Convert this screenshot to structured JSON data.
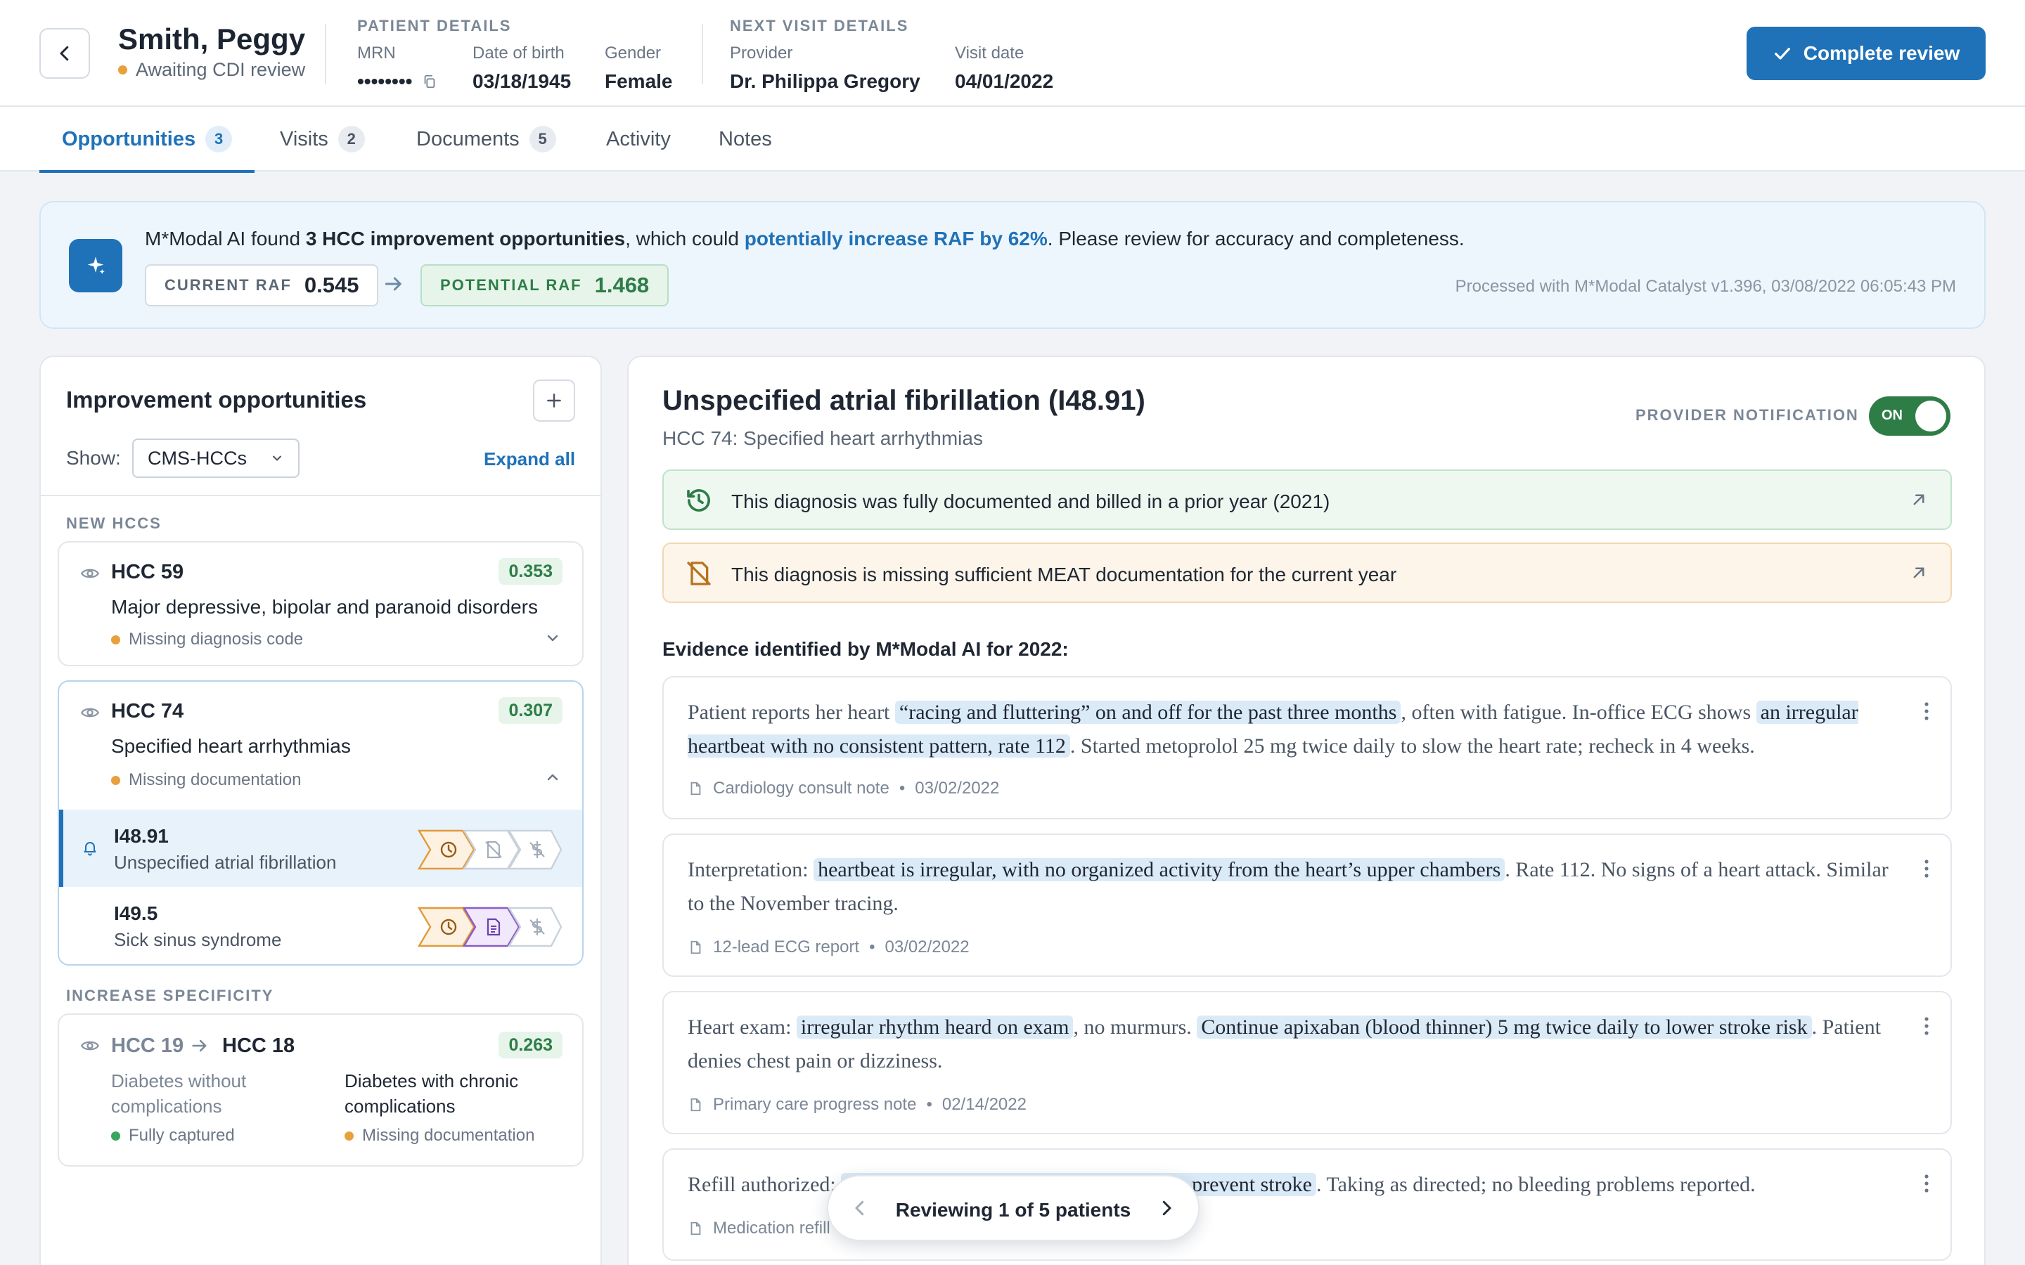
{
  "header": {
    "back_icon": "chevron-left-icon",
    "patient_name": "Smith, Peggy",
    "patient_status": "Awaiting CDI review",
    "patient_details_label": "PATIENT DETAILS",
    "mrn_label": "MRN",
    "mrn_value": "••••••••",
    "dob_label": "Date of birth",
    "dob_value": "03/18/1945",
    "gender_label": "Gender",
    "gender_value": "Female",
    "next_visit_label": "NEXT VISIT DETAILS",
    "provider_label": "Provider",
    "provider_value": "Dr. Philippa Gregory",
    "visit_date_label": "Visit date",
    "visit_date_value": "04/01/2022",
    "complete_button": "Complete review",
    "accent_color": "#1f72b8"
  },
  "tabs": [
    {
      "label": "Opportunities",
      "count": "3",
      "active": true
    },
    {
      "label": "Visits",
      "count": "2",
      "active": false
    },
    {
      "label": "Documents",
      "count": "5",
      "active": false
    },
    {
      "label": "Activity",
      "count": "",
      "active": false
    },
    {
      "label": "Notes",
      "count": "",
      "active": false
    }
  ],
  "banner": {
    "text_prefix": "M*Modal AI found ",
    "text_bold": "3 HCC improvement opportunities",
    "text_mid": ", which could ",
    "text_highlight": "potentially increase RAF by 62%",
    "text_suffix": ". Please review for accuracy and completeness.",
    "current_raf_label": "CURRENT RAF",
    "current_raf_value": "0.545",
    "potential_raf_label": "POTENTIAL RAF",
    "potential_raf_value": "1.468",
    "processed": "Processed with M*Modal Catalyst v1.396, 03/08/2022 06:05:43 PM"
  },
  "left": {
    "title": "Improvement opportunities",
    "show_label": "Show:",
    "show_value": "CMS-HCCs",
    "expand_all": "Expand all",
    "new_hccs_label": "NEW HCCS",
    "increase_specificity_label": "INCREASE SPECIFICITY",
    "hcc59": {
      "code": "HCC 59",
      "score": "0.353",
      "desc": "Major depressive, bipolar and paranoid disorders",
      "status": "Missing diagnosis code"
    },
    "hcc74": {
      "code": "HCC 74",
      "score": "0.307",
      "desc": "Specified heart arrhythmias",
      "status": "Missing documentation",
      "codes": [
        {
          "id": "I48.91",
          "desc": "Unspecified atrial fibrillation"
        },
        {
          "id": "I49.5",
          "desc": "Sick sinus syndrome"
        }
      ]
    },
    "spec": {
      "from_code": "HCC 19",
      "to_code": "HCC 18",
      "score": "0.263",
      "from_desc": "Diabetes without complications",
      "from_status": "Fully captured",
      "to_desc": "Diabetes with chronic complications",
      "to_status": "Missing documentation"
    }
  },
  "right": {
    "title": "Unspecified atrial fibrillation (I48.91)",
    "subtitle": "HCC 74: Specified heart arrhythmias",
    "provider_notification_label": "PROVIDER NOTIFICATION",
    "toggle_label": "ON",
    "alert_prior": "This diagnosis was fully documented and billed in a prior year (2021)",
    "alert_meat": "This diagnosis is missing sufficient MEAT documentation for the current year",
    "evidence_title": "Evidence identified by M*Modal AI for 2022:",
    "evidence": [
      {
        "t1": "Patient reports her heart ",
        "m1": "“racing and fluttering” on and off for the past three months",
        "t2": ", often with fatigue. In-office ECG shows ",
        "m2": "an irregular heartbeat with no consistent pattern, rate 112",
        "t3": ". Started metoprolol 25 mg twice daily to slow the heart rate; recheck in 4 weeks.",
        "source": "Cardiology consult note",
        "date": "03/02/2022"
      },
      {
        "t1": "Interpretation: ",
        "m1": "heartbeat is irregular, with no organized activity from the heart’s upper chambers",
        "t2": ". Rate 112. No signs of a heart attack. Similar to the November tracing.",
        "source": "12-lead ECG report",
        "date": "03/02/2022"
      },
      {
        "t1": "Heart exam: ",
        "m1": "irregular rhythm heard on exam",
        "t2": ", no murmurs. ",
        "m2": "Continue apixaban (blood thinner) 5 mg twice daily to lower stroke risk",
        "t3": ". Patient denies chest pain or dizziness.",
        "source": "Primary care progress note",
        "date": "02/14/2022"
      },
      {
        "t1": "Refill authorized: ",
        "m1": "apixaban 5 mg twice daily, prescribed to prevent stroke",
        "t2": ". Taking as directed; no bleeding problems reported.",
        "source": "Medication refill",
        "date": ""
      }
    ]
  },
  "pager": {
    "text": "Reviewing 1 of 5 patients"
  }
}
